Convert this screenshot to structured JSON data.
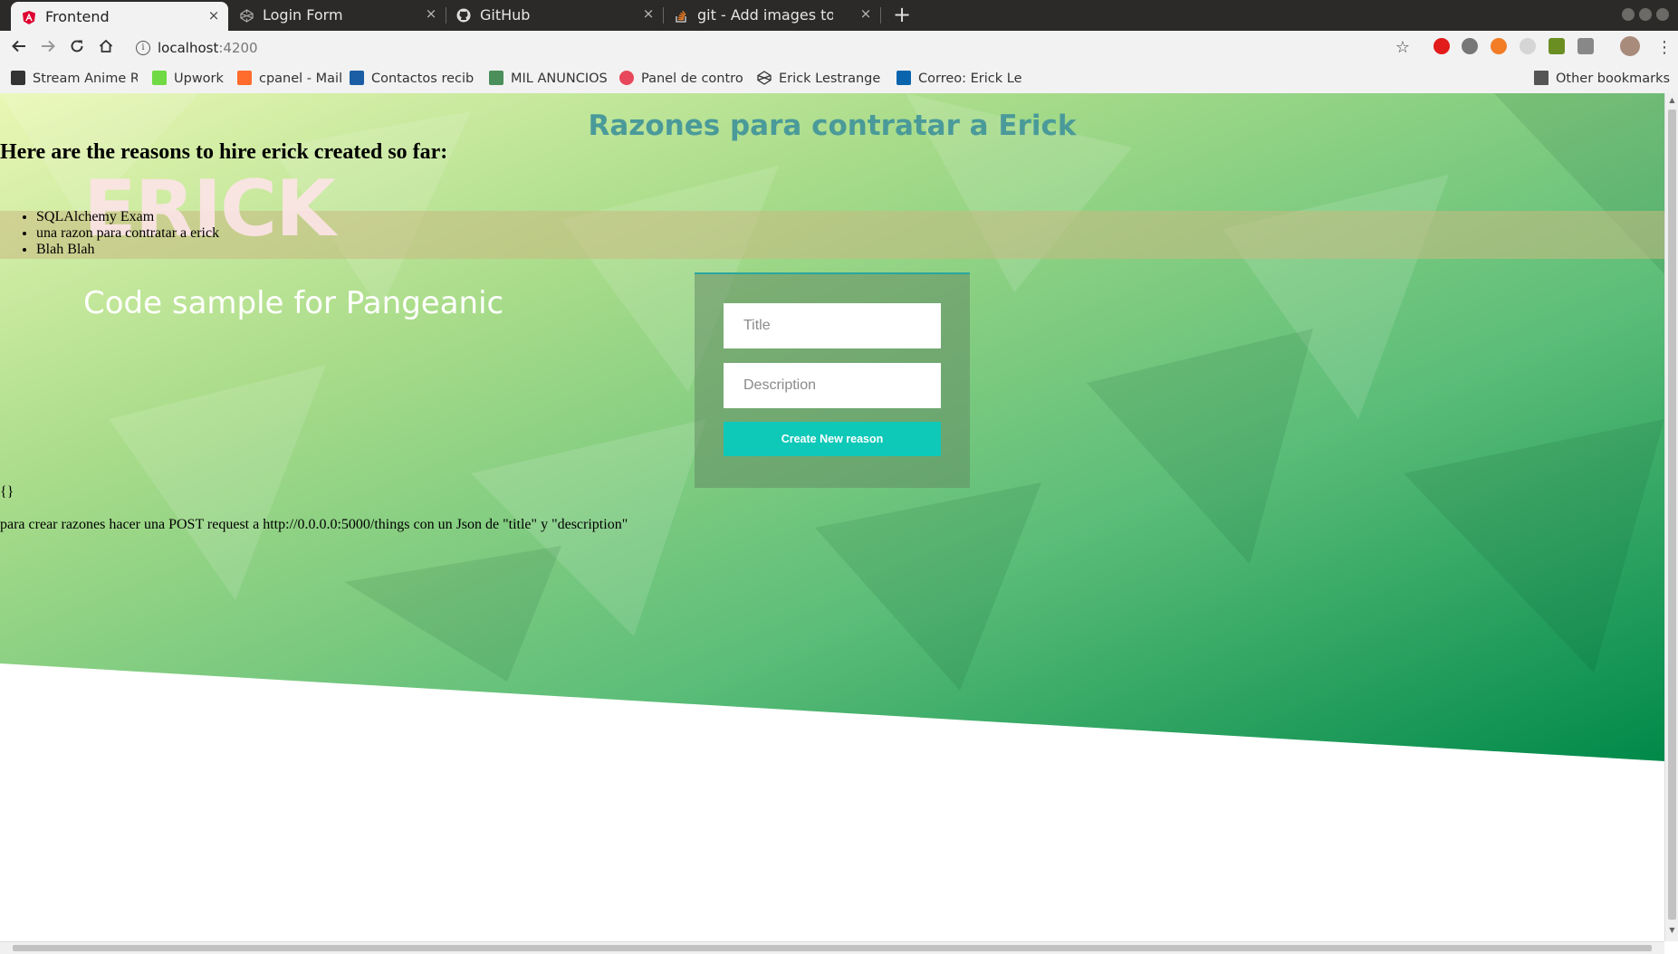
{
  "browser": {
    "tabs": [
      {
        "title": "Frontend",
        "active": true,
        "icon": "angular-icon"
      },
      {
        "title": "Login Form",
        "active": false,
        "icon": "codepen-icon"
      },
      {
        "title": "GitHub",
        "active": false,
        "icon": "github-icon"
      },
      {
        "title": "git - Add images to READM",
        "active": false,
        "icon": "stackoverflow-icon"
      }
    ],
    "new_tab_label": "+",
    "close_glyph": "×",
    "url": {
      "host": "localhost",
      "port": ":4200"
    },
    "bookmarks": [
      {
        "label": "Stream Anime R",
        "icon": "stream-anime-icon"
      },
      {
        "label": "Upwork",
        "icon": "upwork-icon",
        "color": "#6fda44"
      },
      {
        "label": "cpanel - Mail",
        "icon": "cpanel-icon",
        "color": "#ff6c2c"
      },
      {
        "label": "Contactos recibi",
        "icon": "tus-icon",
        "color": "#1b5ea6"
      },
      {
        "label": "MIL ANUNCIOS",
        "icon": "milanuncios-icon",
        "color": "#4b8f5a"
      },
      {
        "label": "Panel de control",
        "icon": "panel-control-icon",
        "color": "#e8485b"
      },
      {
        "label": "Erick Lestrange",
        "icon": "codepen-icon"
      },
      {
        "label": "Correo: Erick Les",
        "icon": "outlook-icon",
        "color": "#0a64ad"
      }
    ],
    "other_bookmarks": "Other bookmarks"
  },
  "page": {
    "heading": "Razones para contratar a Erick",
    "big_name": "ERICK",
    "reasons_heading": "Here are the reasons to hire erick created so far:",
    "reasons": [
      "SQLAlchemy Exam",
      "una razon para contratar a erick",
      "Blah Blah"
    ],
    "subtitle": "Code sample for Pangeanic",
    "form": {
      "title_placeholder": "Title",
      "description_placeholder": "Description",
      "submit_label": "Create New reason"
    },
    "json_output": "{}",
    "help_text": "para crear razones hacer una POST request a http://0.0.0.0:5000/things con un Json de \"title\" y \"description\""
  },
  "colors": {
    "heading": "#4a9a9a",
    "button": "#0ec8b8",
    "accent_border": "#2aa6a0"
  }
}
